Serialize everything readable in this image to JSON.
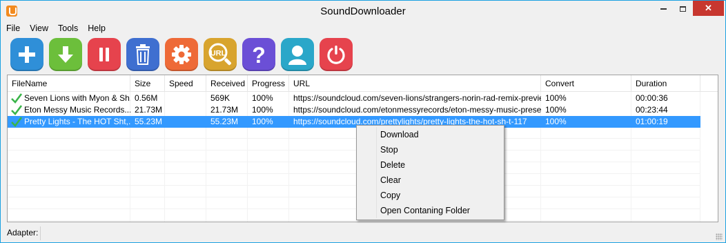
{
  "window": {
    "title": "SoundDownloader",
    "close_label": "✕"
  },
  "menu": [
    "File",
    "View",
    "Tools",
    "Help"
  ],
  "toolbar": [
    {
      "name": "add-button",
      "icon": "plus-icon",
      "color": "#2f8fd8"
    },
    {
      "name": "download-button",
      "icon": "download-arrow-icon",
      "color": "#6cbf3b"
    },
    {
      "name": "pause-button",
      "icon": "pause-icon",
      "color": "#e6434d"
    },
    {
      "name": "delete-button",
      "icon": "trash-icon",
      "color": "#3f6fd0"
    },
    {
      "name": "settings-button",
      "icon": "gear-icon",
      "color": "#ee6a37"
    },
    {
      "name": "url-button",
      "icon": "url-search-icon",
      "color": "#d8a42e",
      "text": "URL"
    },
    {
      "name": "help-button",
      "icon": "question-icon",
      "color": "#6b4fd6",
      "text": "?"
    },
    {
      "name": "account-button",
      "icon": "user-icon",
      "color": "#2aa7c9"
    },
    {
      "name": "power-button",
      "icon": "power-icon",
      "color": "#e6434d"
    }
  ],
  "columns": [
    "FileName",
    "Size",
    "Speed",
    "Received",
    "Progress",
    "URL",
    "Convert",
    "Duration"
  ],
  "rows": [
    {
      "file": "Seven Lions with Myon & Sh...",
      "size": "0.56M",
      "speed": "",
      "received": "569K",
      "progress": "100%",
      "url": "https://soundcloud.com/seven-lions/strangers-norin-rad-remix-preview",
      "convert": "100%",
      "duration": "00:00:36",
      "status_icon": "checkmark-icon",
      "selected": false
    },
    {
      "file": "Eton Messy Music Records.....",
      "size": "21.73M",
      "speed": "",
      "received": "21.73M",
      "progress": "100%",
      "url": "https://soundcloud.com/etonmessyrecords/eton-messy-music-present...",
      "convert": "100%",
      "duration": "00:23:44",
      "status_icon": "checkmark-icon",
      "selected": false
    },
    {
      "file": "Pretty Lights - The HOT Sht,...",
      "size": "55.23M",
      "speed": "",
      "received": "55.23M",
      "progress": "100%",
      "url": "https://soundcloud.com/prettylights/pretty-lights-the-hot-sh-t-117",
      "convert": "100%",
      "duration": "01:00:19",
      "status_icon": "checkmark-icon",
      "selected": true
    }
  ],
  "context_menu": [
    "Download",
    "Stop",
    "Delete",
    "Clear",
    "Copy",
    "Open Contaning Folder"
  ],
  "status": {
    "label": "Adapter:"
  }
}
